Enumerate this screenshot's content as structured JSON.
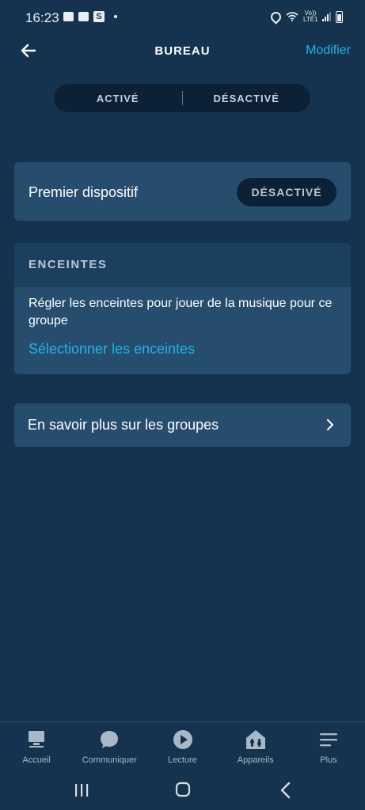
{
  "status_bar": {
    "time": "16:23",
    "left_icons": [
      "gallery-icon",
      "mail-icon",
      "s-icon",
      "dot-icon"
    ],
    "s_badge": "S",
    "lte_label": "Vo)) LTE1",
    "right_icons": [
      "location-icon",
      "wifi-icon",
      "lte-icon",
      "signal-icon",
      "battery-icon"
    ]
  },
  "header": {
    "title": "BUREAU",
    "edit_label": "Modifier",
    "back_icon": "arrow-left-icon"
  },
  "toggle": {
    "on_label": "ACTIVÉ",
    "off_label": "DÉSACTIVÉ"
  },
  "device": {
    "name": "Premier dispositif",
    "status": "DÉSACTIVÉ"
  },
  "speakers": {
    "heading": "ENCEINTES",
    "description": "Régler les enceintes pour jouer de la musique pour ce groupe",
    "link": "Sélectionner les enceintes"
  },
  "learn_more": {
    "label": "En savoir plus sur les groupes",
    "icon": "chevron-right-icon"
  },
  "tabs": [
    {
      "label": "Accueil",
      "icon": "home-icon"
    },
    {
      "label": "Communiquer",
      "icon": "chat-bubble-icon"
    },
    {
      "label": "Lecture",
      "icon": "play-icon"
    },
    {
      "label": "Appareils",
      "icon": "devices-icon"
    },
    {
      "label": "Plus",
      "icon": "menu-icon"
    }
  ],
  "colors": {
    "background": "#15334f",
    "card": "#264d6e",
    "accent": "#1fb3e8",
    "pill": "#0d2136"
  }
}
